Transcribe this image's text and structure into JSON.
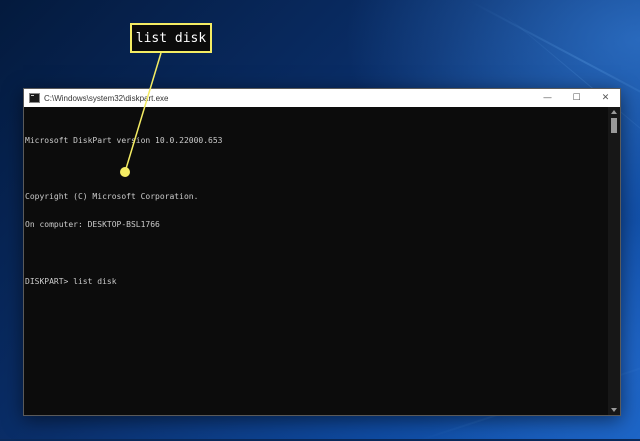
{
  "window": {
    "title": "C:\\Windows\\system32\\diskpart.exe",
    "controls": {
      "minimize": "—",
      "maximize": "☐",
      "close": "✕"
    }
  },
  "console": {
    "lines": [
      "Microsoft DiskPart version 10.0.22000.653",
      "",
      "Copyright (C) Microsoft Corporation.",
      "On computer: DESKTOP-BSL1766",
      ""
    ],
    "prompt": "DISKPART> ",
    "command": "list disk"
  },
  "callout": {
    "text": "list disk",
    "color": "#f4ec63"
  },
  "colors": {
    "console_bg": "#0c0c0c",
    "console_text": "#cccccc",
    "accent": "#f4ec63"
  }
}
